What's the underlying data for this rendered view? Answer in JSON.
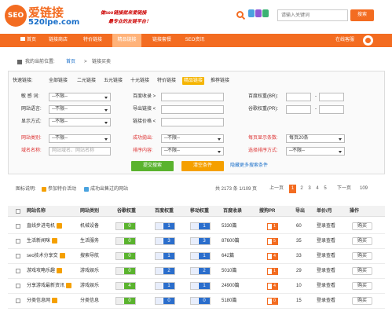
{
  "header": {
    "logo_text": "SEO",
    "site_name": "爱链接",
    "domain": "520lpe.com",
    "slogan_1": "做seo链接就来爱链接",
    "slogan_2": "最专业的友链平台！",
    "search_placeholder": "请输入关键词",
    "search_button": "搜索"
  },
  "nav": {
    "items": [
      "首页",
      "链接商店",
      "特价链接",
      "精品链接",
      "链接套餐",
      "SEO资讯"
    ],
    "active_index": 3,
    "login_text": "在线客服"
  },
  "breadcrumb": {
    "label": "我的当前位置:",
    "home": "首页",
    "sep": ">",
    "current": "链接买卖"
  },
  "quick_links": {
    "label": "快速链接:",
    "items": [
      "全部链接",
      "二元链接",
      "五元链接",
      "十元链接",
      "特价链接",
      "精品链接",
      "推荐链接"
    ],
    "active_index": 5
  },
  "filters": {
    "row1": {
      "l1": "敏 感 词:",
      "v1": "--不限--",
      "l2": "百度收录 >",
      "l3": "百度权重(BR):",
      "dash": "-"
    },
    "row2": {
      "l1": "网站语言:",
      "v1": "--不限--",
      "l2": "导出链接 <",
      "l3": "谷歌权重(PR):",
      "dash": "-"
    },
    "row3": {
      "l1": "显示方式:",
      "v1": "--不限--",
      "l2": "链接价格 <"
    },
    "row4": {
      "l1": "网站类别:",
      "v1": "--不限--",
      "l2": "成功拋出:",
      "v2": "--不限--",
      "l3": "每页显示条数:",
      "v3": "每页20条"
    },
    "row5": {
      "l1": "域名名称:",
      "v1": "网站域名、网站名称",
      "l2": "排序内容:",
      "v2": "--不限--",
      "l3": "选择排序方式:",
      "v3": "--不限--"
    }
  },
  "buttons": {
    "submit": "提交搜索",
    "clear": "清空条件",
    "advanced": "隐藏更多搜索条件"
  },
  "legend": {
    "label": "图标说明:",
    "item1": "参加特价活动",
    "item2": "成功出售过的网站"
  },
  "pagination": {
    "total": "共 2173 条 1/109 页",
    "prev": "上一页",
    "pages": [
      "1",
      "2",
      "3",
      "4",
      "5"
    ],
    "active": "1",
    "next": "下一页",
    "last": "109"
  },
  "table": {
    "headers": [
      "网站名称",
      "网站类别",
      "谷歌权重",
      "百度权重",
      "移动权重",
      "百度收录",
      "搜狗PR",
      "导出",
      "单价/月",
      "操作"
    ],
    "rows": [
      {
        "name": "直线步进电机",
        "category": "机械设备",
        "google": "0",
        "baidu": "1",
        "mobile": "1",
        "index": "5330篇",
        "pr": "1",
        "export": "60",
        "price": "登录查看",
        "action": "购买"
      },
      {
        "name": "生活新闻咪",
        "category": "生活服务",
        "google": "0",
        "baidu": "3",
        "mobile": "3",
        "index": "87600篇",
        "pr": "5",
        "export": "35",
        "price": "登录查看",
        "action": "购买"
      },
      {
        "name": "seo技术分享交",
        "category": "搜索导航",
        "google": "0",
        "baidu": "1",
        "mobile": "1",
        "index": "642篇",
        "pr": "4",
        "export": "33",
        "price": "登录查看",
        "action": "购买"
      },
      {
        "name": "游戏攻略乐趣",
        "category": "游戏娱乐",
        "google": "0",
        "baidu": "2",
        "mobile": "2",
        "index": "5010篇",
        "pr": "1",
        "export": "29",
        "price": "登录查看",
        "action": "购买"
      },
      {
        "name": "分享游戏最新资讯",
        "category": "游戏娱乐",
        "google": "4",
        "baidu": "1",
        "mobile": "1",
        "index": "24900篇",
        "pr": "4",
        "export": "10",
        "price": "登录查看",
        "action": "购买"
      },
      {
        "name": "分类信息网",
        "category": "分类信息",
        "google": "0",
        "baidu": "0",
        "mobile": "0",
        "index": "5180篇",
        "pr": "0",
        "export": "15",
        "price": "登录查看",
        "action": "购买"
      }
    ]
  },
  "colors": {
    "brand": "#f36c21",
    "google": "#5ab32e",
    "baidu": "#2b6ecc",
    "mobile": "#2b6ecc",
    "pr": "#f36c21"
  }
}
